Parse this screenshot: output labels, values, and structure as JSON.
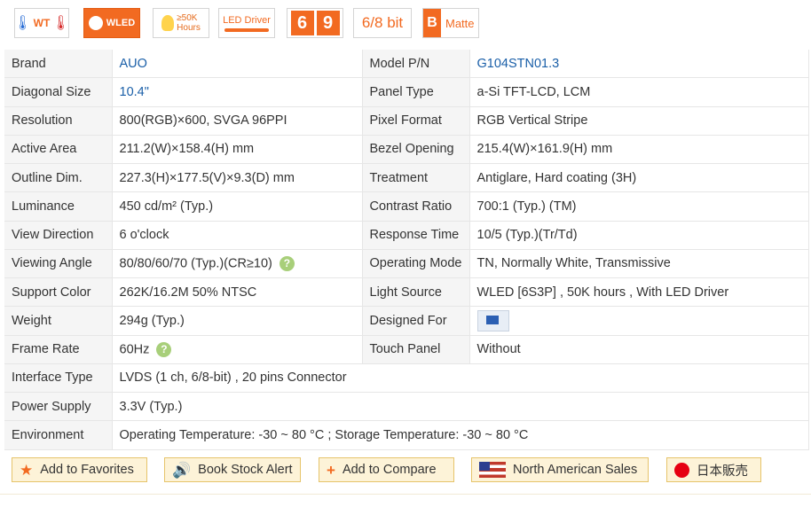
{
  "badges": {
    "wt": "WT",
    "wled": "WLED",
    "hours_top": "≥50K",
    "hours_bottom": "Hours",
    "driver": "LED Driver",
    "digit1": "6",
    "digit2": "9",
    "bit": "6/8 bit",
    "matte_letter": "B",
    "matte": "Matte"
  },
  "specs": [
    {
      "l1": "Brand",
      "v1": "AUO",
      "l2": "Model P/N",
      "v2": "G104STN01.3"
    },
    {
      "l1": "Diagonal Size",
      "v1": "10.4\"",
      "l2": "Panel Type",
      "v2": "a-Si TFT-LCD, LCM"
    },
    {
      "l1": "Resolution",
      "v1": "800(RGB)×600, SVGA  96PPI",
      "l2": "Pixel Format",
      "v2": "RGB Vertical Stripe"
    },
    {
      "l1": "Active Area",
      "v1": "211.2(W)×158.4(H) mm",
      "l2": "Bezel Opening",
      "v2": "215.4(W)×161.9(H) mm"
    },
    {
      "l1": "Outline Dim.",
      "v1": "227.3(H)×177.5(V)×9.3(D) mm",
      "l2": "Treatment",
      "v2": "Antiglare, Hard coating (3H)"
    },
    {
      "l1": "Luminance",
      "v1": "450 cd/m² (Typ.)",
      "l2": "Contrast Ratio",
      "v2": "700:1 (Typ.) (TM)"
    },
    {
      "l1": "View Direction",
      "v1": "6 o'clock",
      "l2": "Response Time",
      "v2": "10/5 (Typ.)(Tr/Td)"
    },
    {
      "l1": "Viewing Angle",
      "v1": "80/80/60/70 (Typ.)(CR≥10)",
      "l2": "Operating Mode",
      "v2": "TN, Normally White, Transmissive"
    },
    {
      "l1": "Support Color",
      "v1": "262K/16.2M   50% NTSC",
      "l2": "Light Source",
      "v2": "WLED  [6S3P] , 50K hours , With LED Driver"
    },
    {
      "l1": "Weight",
      "v1": "294g (Typ.)",
      "l2": "Designed For",
      "v2": ""
    },
    {
      "l1": "Frame Rate",
      "v1": "60Hz",
      "l2": "Touch Panel",
      "v2": "Without"
    }
  ],
  "wide_specs": [
    {
      "label": "Interface Type",
      "value": "LVDS (1 ch, 6/8-bit) , 20 pins Connector"
    },
    {
      "label": "Power Supply",
      "value": "3.3V (Typ.)"
    },
    {
      "label": "Environment",
      "value": "Operating Temperature: -30 ~ 80 °C ; Storage Temperature: -30 ~ 80 °C"
    }
  ],
  "help_glyph": "?",
  "actions": {
    "favorites": "Add to Favorites",
    "stock_alert": "Book Stock Alert",
    "compare": "Add to Compare",
    "na_sales": "North American Sales",
    "japan": "日本販売"
  },
  "colors": {
    "accent": "#f26a21",
    "link": "#1a5fa8",
    "button_bg": "#fdf3d8",
    "help": "#a8cf7a"
  }
}
